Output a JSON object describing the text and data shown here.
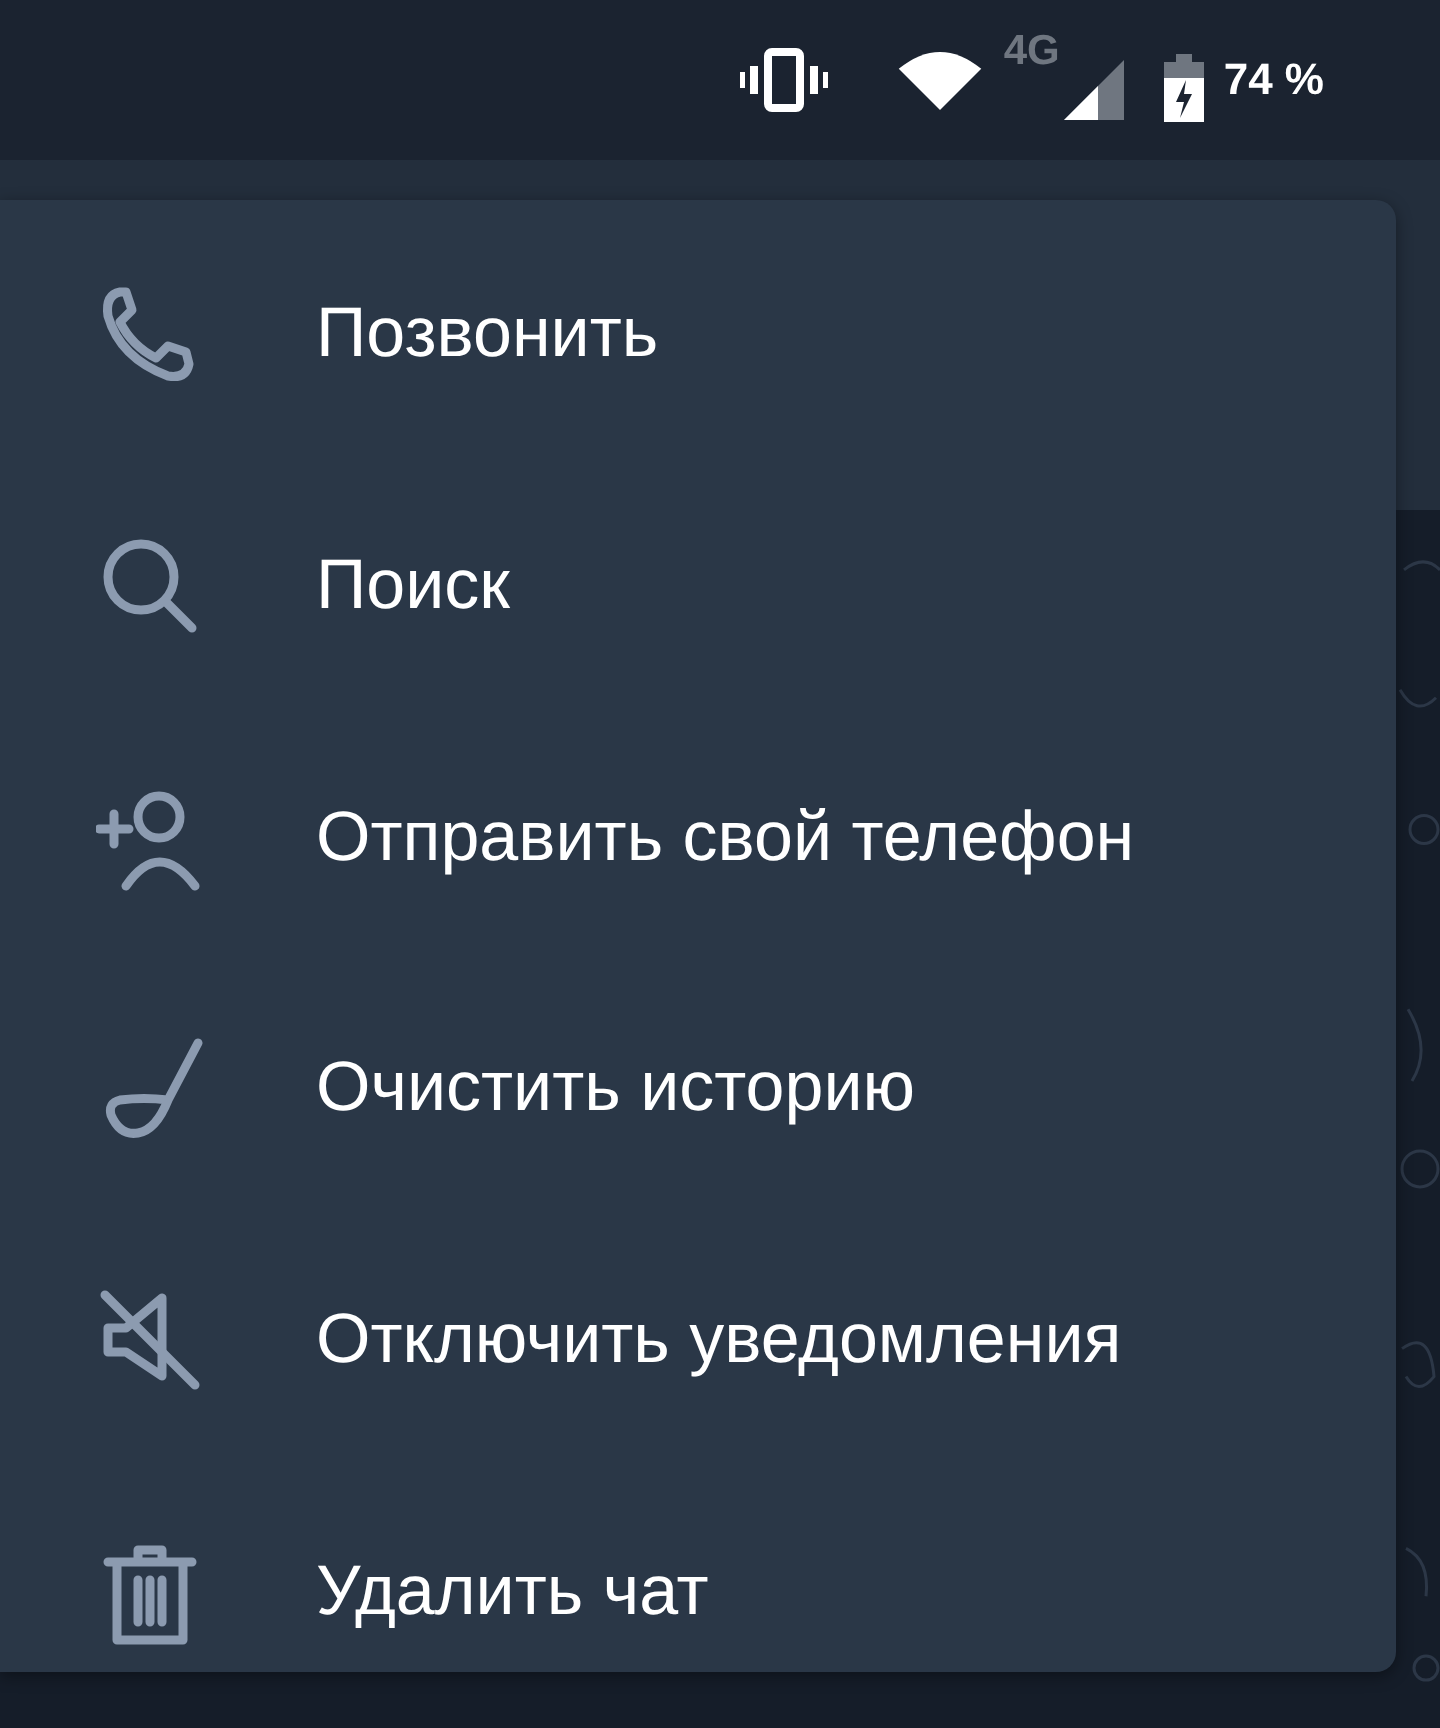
{
  "status_bar": {
    "network_type": "4G",
    "battery": "74 %"
  },
  "menu": {
    "items": [
      {
        "label": "Позвонить"
      },
      {
        "label": "Поиск"
      },
      {
        "label": "Отправить свой телефон"
      },
      {
        "label": "Очистить историю"
      },
      {
        "label": "Отключить уведомления"
      },
      {
        "label": "Удалить чат"
      }
    ]
  }
}
